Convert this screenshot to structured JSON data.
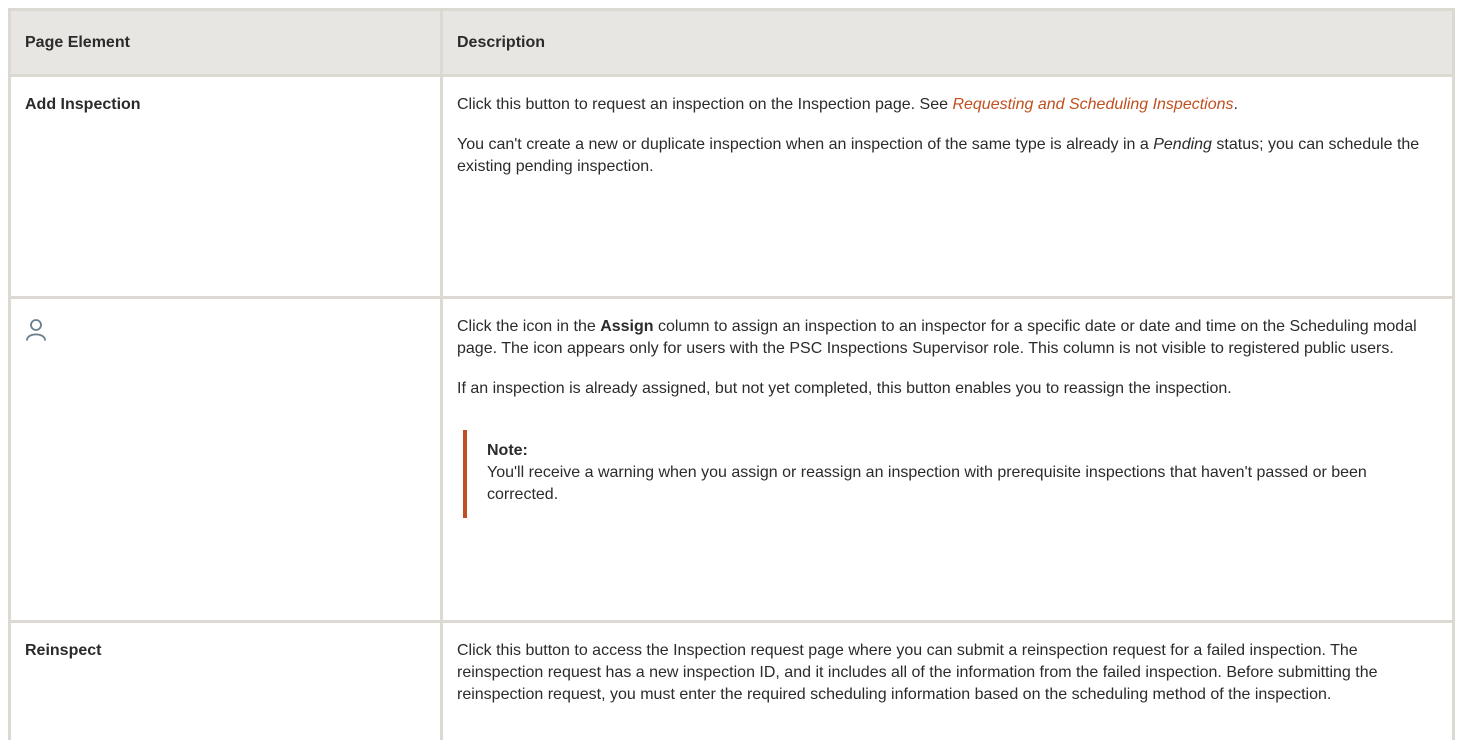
{
  "table": {
    "headers": {
      "col1": "Page Element",
      "col2": "Description"
    },
    "rows": [
      {
        "element": "Add Inspection",
        "p1_before": "Click this button to request an inspection on the Inspection page. See ",
        "p1_link": "Requesting and Scheduling Inspections",
        "p1_after": ".",
        "p2_before": "You can't create a new or duplicate inspection when an inspection of the same type is already in a ",
        "p2_em": "Pending",
        "p2_after": " status; you can schedule the existing pending inspection."
      },
      {
        "element_icon": "user-icon",
        "p1_before": "Click the icon in the ",
        "p1_strong": "Assign",
        "p1_after": " column to assign an inspection to an inspector for a specific date or date and time on the Scheduling modal page. The icon appears only for users with the PSC Inspections Supervisor role. This column is not visible to registered public users.",
        "p2": "If an inspection is already assigned, but not yet completed, this button enables you to reassign the inspection.",
        "note_title": "Note:",
        "note_text": "You'll receive a warning when you assign or reassign an inspection with prerequisite inspections that haven't passed or been corrected."
      },
      {
        "element": "Reinspect",
        "p1": "Click this button to access the Inspection request page where you can submit a reinspection request for a failed inspection. The reinspection request has a new inspection ID, and it includes all of the information from the failed inspection. Before submitting the reinspection request, you must enter the required scheduling information based on the scheduling method of the inspection."
      }
    ]
  },
  "colors": {
    "header_bg": "#e8e6e2",
    "border": "#dcd8d2",
    "link": "#c0501f",
    "note_bar": "#c0501f",
    "icon": "#6c7f8d"
  }
}
